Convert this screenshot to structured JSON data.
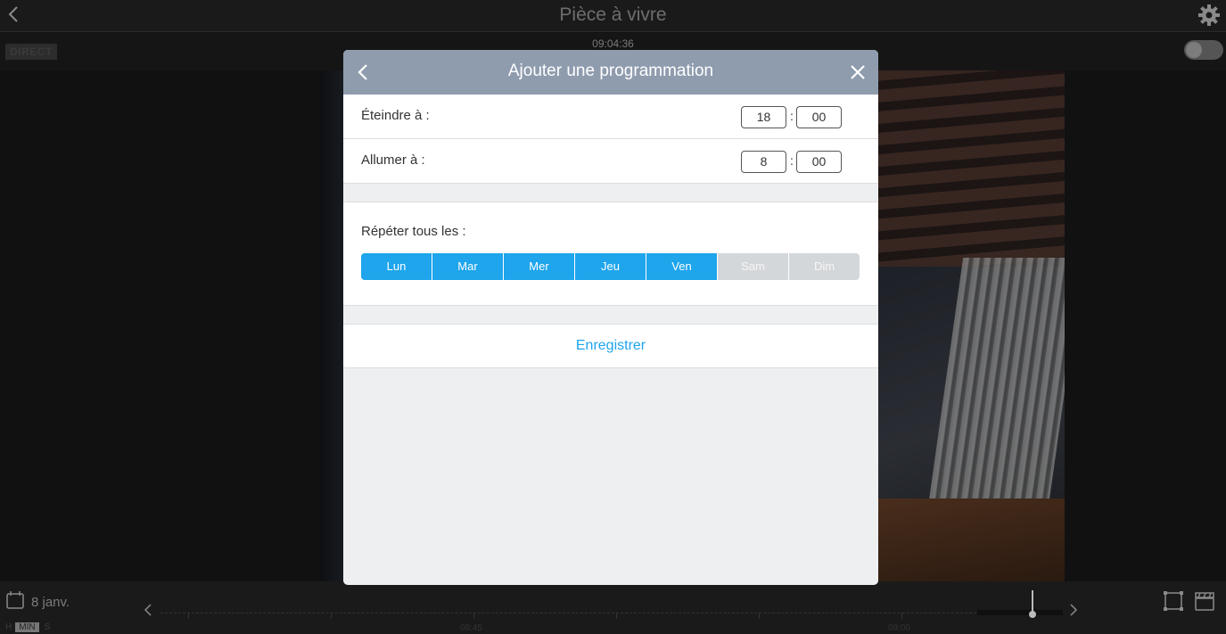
{
  "topbar": {
    "title": "Pièce à vivre"
  },
  "subbar": {
    "live_label": "DIRECT",
    "clock": "09:04:36"
  },
  "bottombar": {
    "date": "8 janv.",
    "scale_hours": "H",
    "scale_minutes": "MIN",
    "scale_seconds": "S",
    "timeline_labels": [
      "08:45",
      "09:00"
    ]
  },
  "modal": {
    "title": "Ajouter une programmation",
    "off_label": "Éteindre à :",
    "off_hours": "18",
    "off_minutes": "00",
    "on_label": "Allumer à :",
    "on_hours": "8",
    "on_minutes": "00",
    "time_separator": ":",
    "repeat_label": "Répéter tous les :",
    "days": [
      {
        "label": "Lun",
        "active": true
      },
      {
        "label": "Mar",
        "active": true
      },
      {
        "label": "Mer",
        "active": true
      },
      {
        "label": "Jeu",
        "active": true
      },
      {
        "label": "Ven",
        "active": true
      },
      {
        "label": "Sam",
        "active": false
      },
      {
        "label": "Dim",
        "active": false
      }
    ],
    "save_label": "Enregistrer"
  },
  "colors": {
    "accent": "#1ea5ec",
    "header": "#8f9cae",
    "inactive_day": "#d4d7da"
  }
}
